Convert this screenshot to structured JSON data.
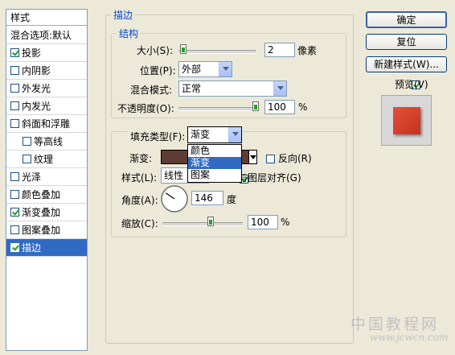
{
  "style_list": {
    "header": "样式",
    "blend_options": "混合选项:默认",
    "items": [
      {
        "label": "投影",
        "checked": true
      },
      {
        "label": "内阴影",
        "checked": false
      },
      {
        "label": "外发光",
        "checked": false
      },
      {
        "label": "内发光",
        "checked": false
      },
      {
        "label": "斜面和浮雕",
        "checked": false
      },
      {
        "label": "等高线",
        "checked": false
      },
      {
        "label": "纹理",
        "checked": false
      },
      {
        "label": "光泽",
        "checked": false
      },
      {
        "label": "颜色叠加",
        "checked": false
      },
      {
        "label": "渐变叠加",
        "checked": true
      },
      {
        "label": "图案叠加",
        "checked": false
      },
      {
        "label": "描边",
        "checked": true
      }
    ]
  },
  "stroke": {
    "group_title": "描边",
    "structure": {
      "title": "结构",
      "size_label": "大小(S):",
      "size_value": "2",
      "size_unit": "像素",
      "position_label": "位置(P):",
      "position_value": "外部",
      "blend_label": "混合模式:",
      "blend_value": "正常",
      "opacity_label": "不透明度(O):",
      "opacity_value": "100",
      "opacity_unit": "%",
      "size_slider_fraction": 0.02,
      "opacity_slider_fraction": 1.0
    },
    "fill": {
      "fill_type_label": "填充类型(F):",
      "fill_type_value": "渐变",
      "dropdown_options": [
        "颜色",
        "渐变",
        "图案"
      ],
      "gradient_label": "渐变:",
      "reverse_label": "反向(R)",
      "style_label": "样式(L):",
      "style_value": "线性",
      "align_label": "与图层对齐(G)",
      "angle_label": "角度(A):",
      "angle_value": "146",
      "angle_unit": "度",
      "scale_label": "缩放(C):",
      "scale_value": "100",
      "scale_unit": "%",
      "scale_slider_fraction": 0.5
    }
  },
  "buttons": {
    "ok": "确定",
    "reset": "复位",
    "new_style": "新建样式(W)...",
    "preview": "预览(V)"
  },
  "watermark": {
    "line1": "中国教程网",
    "line2": "www.jcwcn.com"
  },
  "colors": {
    "selection": "#316ac5",
    "gradient_swatch": "#5e3b35",
    "preview_swatch": "#e0503a"
  }
}
